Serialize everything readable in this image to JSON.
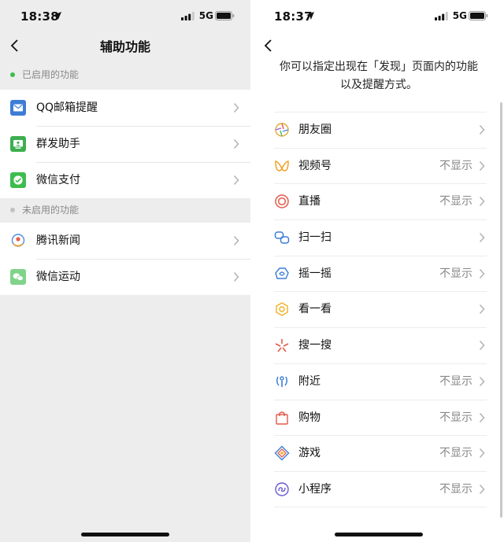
{
  "left": {
    "status": {
      "time": "18:38",
      "network": "5G"
    },
    "nav": {
      "title": "辅助功能"
    },
    "enabled_section": {
      "label": "已启用的功能",
      "dot_color": "#3dbd4d"
    },
    "enabled_items": [
      {
        "label": "QQ邮箱提醒",
        "icon": "mail-icon",
        "color": "#3d7dd6"
      },
      {
        "label": "群发助手",
        "icon": "broadcast-icon",
        "color": "#3dae4f"
      },
      {
        "label": "微信支付",
        "icon": "wechat-pay-icon",
        "color": "#3dbd4d"
      }
    ],
    "disabled_section": {
      "label": "未启用的功能",
      "dot_color": "#c2c2c2"
    },
    "disabled_items": [
      {
        "label": "腾讯新闻",
        "icon": "tencent-news-icon",
        "color": "#3d7dd6"
      },
      {
        "label": "微信运动",
        "icon": "wechat-sport-icon",
        "color": "#7fd38a"
      }
    ]
  },
  "right": {
    "status": {
      "time": "18:37",
      "network": "5G"
    },
    "intro_line1": "你可以指定出现在「发现」页面内的功能",
    "intro_line2": "以及提醒方式。",
    "items": [
      {
        "label": "朋友圈",
        "state": "",
        "icon": "moments-icon"
      },
      {
        "label": "视频号",
        "state": "不显示",
        "icon": "channels-icon"
      },
      {
        "label": "直播",
        "state": "不显示",
        "icon": "live-icon"
      },
      {
        "label": "扫一扫",
        "state": "",
        "icon": "scan-icon"
      },
      {
        "label": "摇一摇",
        "state": "不显示",
        "icon": "shake-icon"
      },
      {
        "label": "看一看",
        "state": "",
        "icon": "top-stories-icon"
      },
      {
        "label": "搜一搜",
        "state": "",
        "icon": "search-icon"
      },
      {
        "label": "附近",
        "state": "不显示",
        "icon": "nearby-icon"
      },
      {
        "label": "购物",
        "state": "不显示",
        "icon": "shopping-bag-icon"
      },
      {
        "label": "游戏",
        "state": "不显示",
        "icon": "games-icon"
      },
      {
        "label": "小程序",
        "state": "不显示",
        "icon": "mini-programs-icon"
      }
    ]
  }
}
